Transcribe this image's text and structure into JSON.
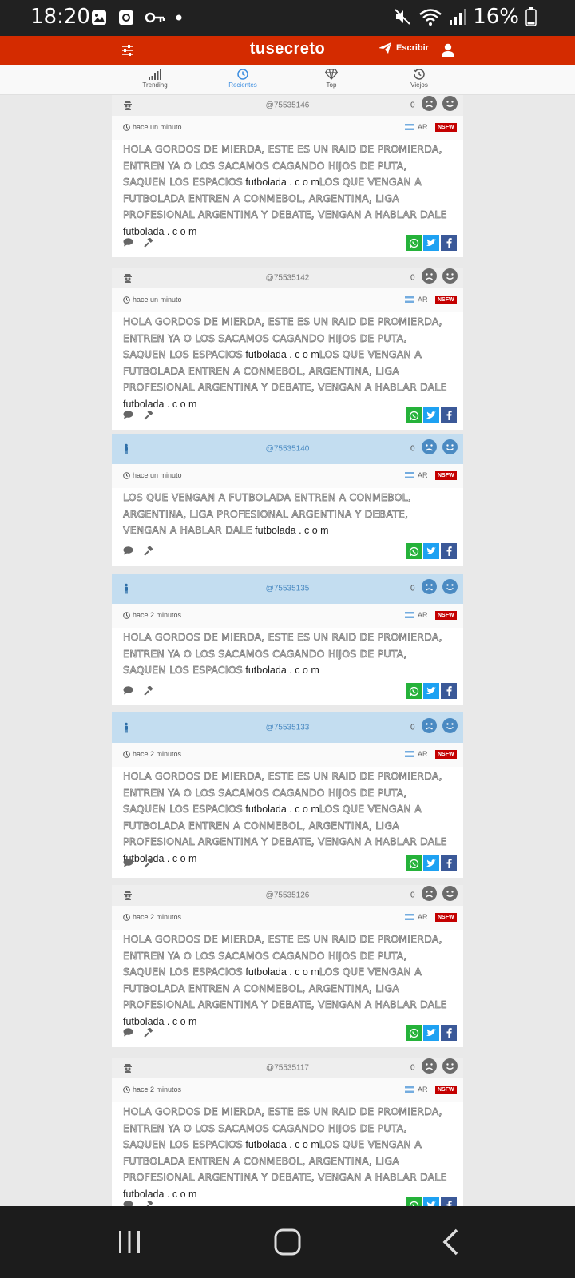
{
  "status_bar": {
    "time": "18:20",
    "battery": "16%"
  },
  "app": {
    "logo": "tusecreto",
    "write_label": "Escribir"
  },
  "tabs": [
    {
      "label": "Trending",
      "icon": "signal-bars-icon",
      "active": false
    },
    {
      "label": "Recientes",
      "icon": "clock-icon",
      "active": true
    },
    {
      "label": "Top",
      "icon": "diamond-icon",
      "active": false
    },
    {
      "label": "Viejos",
      "icon": "history-icon",
      "active": false
    }
  ],
  "posts": [
    {
      "handle": "@75535146",
      "score": "0",
      "time": "hace un minuto",
      "country": "AR",
      "nsfw": "NSFW",
      "role": "spy",
      "segments": [
        {
          "t": "HOLA GORDOS DE MIERDA, ESTE ES UN RAID DE PROMIERDA, ENTREN YA O LOS SACAMOS CAGANDO HIJOS DE PUTA, SAQUEN LOS ESPACIOS",
          "s": true
        },
        {
          "t": " futbolada . c o m",
          "s": false
        },
        {
          "t": "LOS QUE VENGAN A FUTBOLADA ENTREN A CONMEBOL, ARGENTINA, LIGA PROFESIONAL ARGENTINA Y DEBATE, VENGAN A HABLAR DALE",
          "s": true
        },
        {
          "t": " futbolada . c o m",
          "s": false
        }
      ]
    },
    {
      "handle": "@75535142",
      "score": "0",
      "time": "hace un minuto",
      "country": "AR",
      "nsfw": "NSFW",
      "role": "spy",
      "segments": [
        {
          "t": "HOLA GORDOS DE MIERDA, ESTE ES UN RAID DE PROMIERDA, ENTREN YA O LOS SACAMOS CAGANDO HIJOS DE PUTA, SAQUEN LOS ESPACIOS",
          "s": true
        },
        {
          "t": " futbolada . c o m",
          "s": false
        },
        {
          "t": "LOS QUE VENGAN A FUTBOLADA ENTREN A CONMEBOL, ARGENTINA, LIGA PROFESIONAL ARGENTINA Y DEBATE, VENGAN A HABLAR DALE",
          "s": true
        },
        {
          "t": " futbolada . c o m",
          "s": false
        }
      ]
    },
    {
      "handle": "@75535140",
      "score": "0",
      "time": "hace un minuto",
      "country": "AR",
      "nsfw": "NSFW",
      "role": "male",
      "segments": [
        {
          "t": "LOS QUE VENGAN A FUTBOLADA ENTREN A CONMEBOL, ARGENTINA, LIGA PROFESIONAL ARGENTINA Y DEBATE, VENGAN A HABLAR DALE",
          "s": true
        },
        {
          "t": " futbolada . c o m",
          "s": false
        }
      ]
    },
    {
      "handle": "@75535135",
      "score": "0",
      "time": "hace 2 minutos",
      "country": "AR",
      "nsfw": "NSFW",
      "role": "male",
      "segments": [
        {
          "t": "HOLA GORDOS DE MIERDA, ESTE ES UN RAID DE PROMIERDA, ENTREN YA O LOS SACAMOS CAGANDO HIJOS DE PUTA, SAQUEN LOS ESPACIOS",
          "s": true
        },
        {
          "t": " futbolada . c o m",
          "s": false
        }
      ]
    },
    {
      "handle": "@75535133",
      "score": "0",
      "time": "hace 2 minutos",
      "country": "AR",
      "nsfw": "NSFW",
      "role": "male",
      "segments": [
        {
          "t": "HOLA GORDOS DE MIERDA, ESTE ES UN RAID DE PROMIERDA, ENTREN YA O LOS SACAMOS CAGANDO HIJOS DE PUTA, SAQUEN LOS ESPACIOS",
          "s": true
        },
        {
          "t": " futbolada . c o m",
          "s": false
        },
        {
          "t": "LOS QUE VENGAN A FUTBOLADA ENTREN A CONMEBOL, ARGENTINA, LIGA PROFESIONAL ARGENTINA Y DEBATE, VENGAN A HABLAR DALE",
          "s": true
        },
        {
          "t": " futbolada . c o m",
          "s": false
        }
      ]
    },
    {
      "handle": "@75535126",
      "score": "0",
      "time": "hace 2 minutos",
      "country": "AR",
      "nsfw": "NSFW",
      "role": "spy",
      "segments": [
        {
          "t": "HOLA GORDOS DE MIERDA, ESTE ES UN RAID DE PROMIERDA, ENTREN YA O LOS SACAMOS CAGANDO HIJOS DE PUTA, SAQUEN LOS ESPACIOS",
          "s": true
        },
        {
          "t": " futbolada . c o m",
          "s": false
        },
        {
          "t": "LOS QUE VENGAN A FUTBOLADA ENTREN A CONMEBOL, ARGENTINA, LIGA PROFESIONAL ARGENTINA Y DEBATE, VENGAN A HABLAR DALE",
          "s": true
        },
        {
          "t": " futbolada . c o m",
          "s": false
        }
      ]
    },
    {
      "handle": "@75535117",
      "score": "0",
      "time": "hace 2 minutos",
      "country": "AR",
      "nsfw": "NSFW",
      "role": "spy",
      "segments": [
        {
          "t": "HOLA GORDOS DE MIERDA, ESTE ES UN RAID DE PROMIERDA, ENTREN YA O LOS SACAMOS CAGANDO HIJOS DE PUTA, SAQUEN LOS ESPACIOS",
          "s": true
        },
        {
          "t": " futbolada . c o m",
          "s": false
        },
        {
          "t": "LOS QUE VENGAN A FUTBOLADA ENTREN A CONMEBOL, ARGENTINA, LIGA PROFESIONAL ARGENTINA Y DEBATE, VENGAN A HABLAR DALE",
          "s": true
        },
        {
          "t": " futbolada . c o m",
          "s": false
        }
      ]
    }
  ],
  "colors": {
    "appbar": "#d42b00",
    "active_tab": "#3b8de0",
    "whatsapp": "#25b23a",
    "twitter": "#1da1f2",
    "facebook": "#3b5998",
    "nsfw": "#c40000"
  }
}
